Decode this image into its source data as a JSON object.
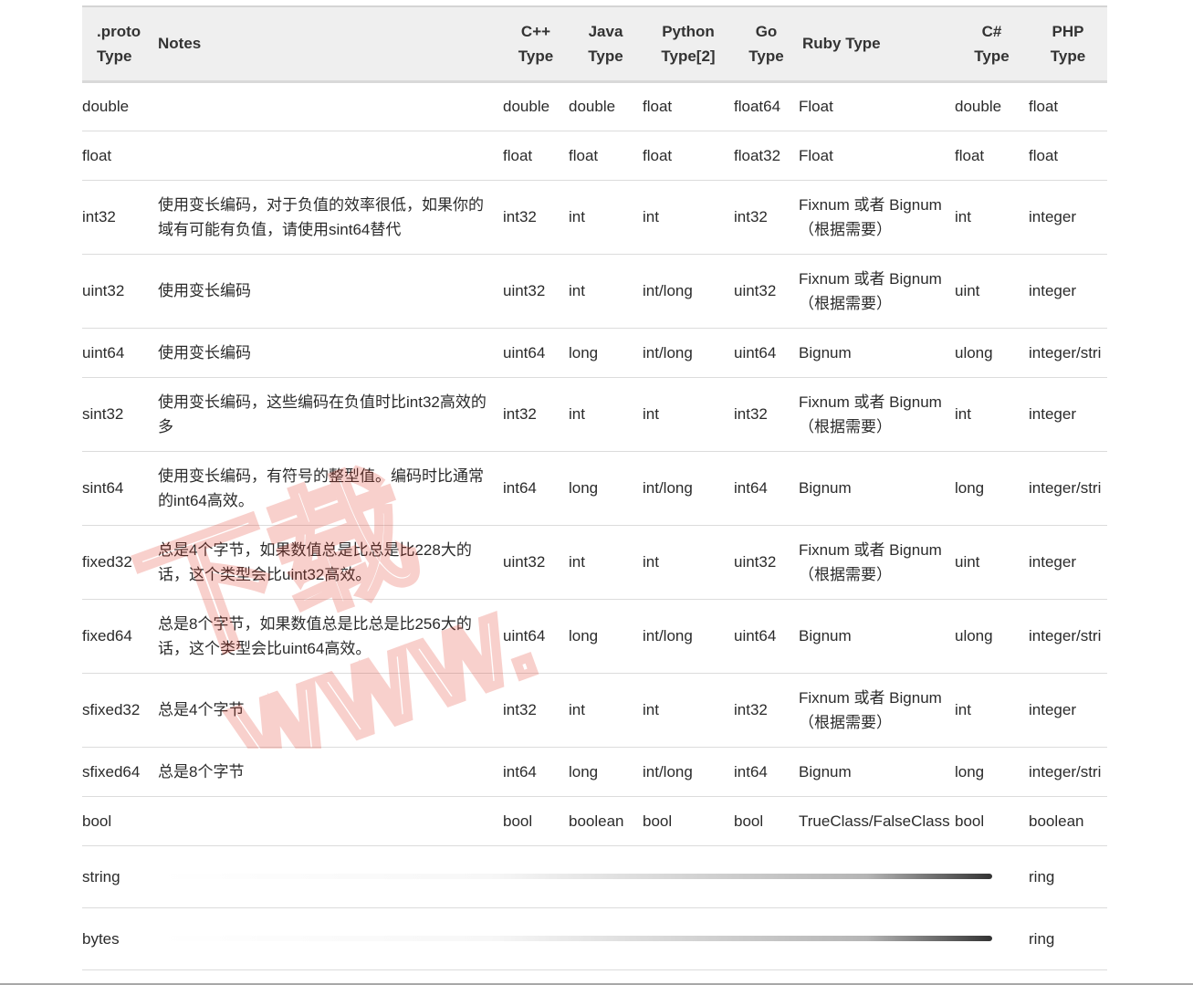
{
  "headers": [
    {
      "line1": ".proto",
      "line2": "Type"
    },
    {
      "line1": "Notes",
      "line2": ""
    },
    {
      "line1": "C++",
      "line2": "Type"
    },
    {
      "line1": "Java",
      "line2": "Type"
    },
    {
      "line1": "Python",
      "line2": "Type[2]"
    },
    {
      "line1": "Go",
      "line2": "Type"
    },
    {
      "line1": "Ruby Type",
      "line2": ""
    },
    {
      "line1": "C#",
      "line2": "Type"
    },
    {
      "line1": "PHP",
      "line2": "Type"
    }
  ],
  "rows": [
    {
      "proto": "double",
      "notes": "",
      "cpp": "double",
      "java": "double",
      "python": "float",
      "go": "float64",
      "ruby": "Float",
      "csharp": "double",
      "php": "float"
    },
    {
      "proto": "float",
      "notes": "",
      "cpp": "float",
      "java": "float",
      "python": "float",
      "go": "float32",
      "ruby": "Float",
      "csharp": "float",
      "php": "float"
    },
    {
      "proto": "int32",
      "notes": "使用变长编码，对于负值的效率很低，如果你的域有可能有负值，请使用sint64替代",
      "cpp": "int32",
      "java": "int",
      "python": "int",
      "go": "int32",
      "ruby": "Fixnum 或者 Bignum（根据需要）",
      "csharp": "int",
      "php": "integer"
    },
    {
      "proto": "uint32",
      "notes": "使用变长编码",
      "cpp": "uint32",
      "java": "int",
      "python": "int/long",
      "go": "uint32",
      "ruby": "Fixnum 或者 Bignum（根据需要）",
      "csharp": "uint",
      "php": "integer"
    },
    {
      "proto": "uint64",
      "notes": "使用变长编码",
      "cpp": "uint64",
      "java": "long",
      "python": "int/long",
      "go": "uint64",
      "ruby": "Bignum",
      "csharp": "ulong",
      "php": "integer/stri"
    },
    {
      "proto": "sint32",
      "notes": "使用变长编码，这些编码在负值时比int32高效的多",
      "cpp": "int32",
      "java": "int",
      "python": "int",
      "go": "int32",
      "ruby": "Fixnum 或者 Bignum（根据需要）",
      "csharp": "int",
      "php": "integer"
    },
    {
      "proto": "sint64",
      "notes": "使用变长编码，有符号的整型值。编码时比通常的int64高效。",
      "cpp": "int64",
      "java": "long",
      "python": "int/long",
      "go": "int64",
      "ruby": "Bignum",
      "csharp": "long",
      "php": "integer/stri"
    },
    {
      "proto": "fixed32",
      "notes": "总是4个字节，如果数值总是比总是比228大的话，这个类型会比uint32高效。",
      "cpp": "uint32",
      "java": "int",
      "python": "int",
      "go": "uint32",
      "ruby": "Fixnum 或者 Bignum（根据需要）",
      "csharp": "uint",
      "php": "integer"
    },
    {
      "proto": "fixed64",
      "notes": "总是8个字节，如果数值总是比总是比256大的话，这个类型会比uint64高效。",
      "cpp": "uint64",
      "java": "long",
      "python": "int/long",
      "go": "uint64",
      "ruby": "Bignum",
      "csharp": "ulong",
      "php": "integer/stri"
    },
    {
      "proto": "sfixed32",
      "notes": "总是4个字节",
      "cpp": "int32",
      "java": "int",
      "python": "int",
      "go": "int32",
      "ruby": "Fixnum 或者 Bignum（根据需要）",
      "csharp": "int",
      "php": "integer"
    },
    {
      "proto": "sfixed64",
      "notes": "总是8个字节",
      "cpp": "int64",
      "java": "long",
      "python": "int/long",
      "go": "int64",
      "ruby": "Bignum",
      "csharp": "long",
      "php": "integer/stri"
    },
    {
      "proto": "bool",
      "notes": "",
      "cpp": "bool",
      "java": "boolean",
      "python": "bool",
      "go": "bool",
      "ruby": "TrueClass/FalseClass",
      "csharp": "bool",
      "php": "boolean"
    }
  ],
  "faded_rows": [
    {
      "proto": "string",
      "tail": "ring"
    },
    {
      "proto": "bytes",
      "tail": "ring"
    }
  ],
  "watermark": {
    "line1": "下载",
    "line2": "www."
  }
}
